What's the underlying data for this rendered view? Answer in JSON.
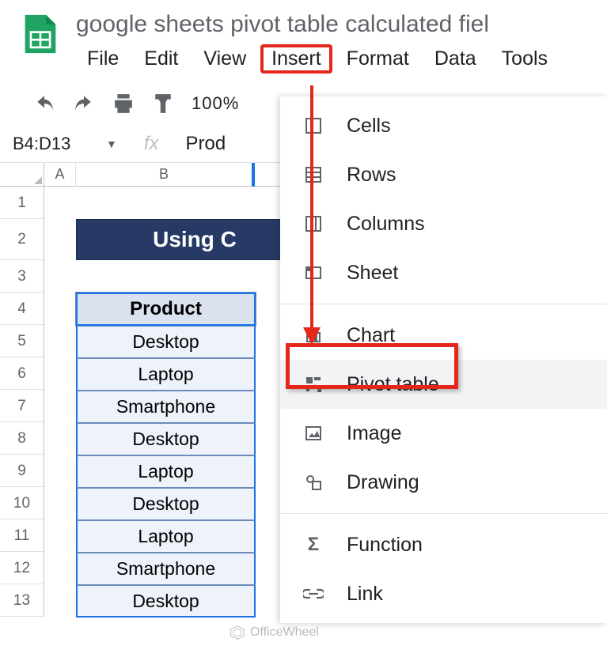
{
  "doc_title": "google sheets pivot table calculated fiel",
  "menu": {
    "file": "File",
    "edit": "Edit",
    "view": "View",
    "insert": "Insert",
    "format": "Format",
    "data": "Data",
    "tools": "Tools"
  },
  "toolbar": {
    "zoom": "100%"
  },
  "name_box": "B4:D13",
  "fx_label": "fx",
  "formula_value": "Prod",
  "col_headers": {
    "a": "A",
    "b": "B"
  },
  "row_headers": [
    "1",
    "2",
    "3",
    "4",
    "5",
    "6",
    "7",
    "8",
    "9",
    "10",
    "11",
    "12",
    "13"
  ],
  "banner_text": "Using C",
  "table": {
    "header": "Product",
    "rows": [
      "Desktop",
      "Laptop",
      "Smartphone",
      "Desktop",
      "Laptop",
      "Desktop",
      "Laptop",
      "Smartphone",
      "Desktop"
    ]
  },
  "insert_menu": {
    "cells": "Cells",
    "rows": "Rows",
    "columns": "Columns",
    "sheet": "Sheet",
    "chart": "Chart",
    "pivot_table": "Pivot table",
    "image": "Image",
    "drawing": "Drawing",
    "function": "Function",
    "link": "Link"
  },
  "watermark": "OfficeWheel"
}
